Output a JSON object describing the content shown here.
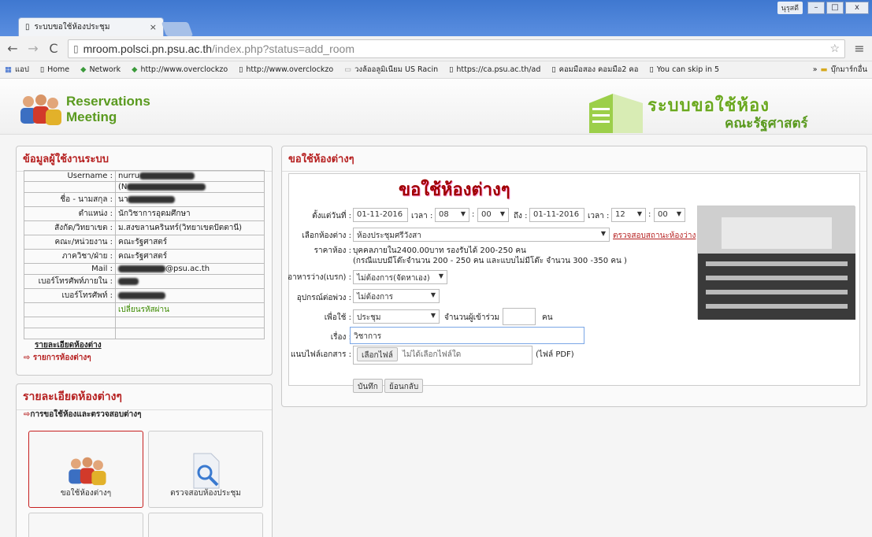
{
  "browser": {
    "tab_title": "ระบบขอใช้ห้องประชุม",
    "tab_close": "×",
    "user_badge": "นุรุสดี",
    "url_host": "mroom.polsci.pn.psu.ac.th",
    "url_path": "/index.php?status=add_room",
    "bookmarks": [
      "แอป",
      "Home",
      "Network",
      "http://www.overclockzo",
      "http://www.overclockzo",
      "วงล้ออลูมิเนียม US Racin",
      "https://ca.psu.ac.th/ad",
      "คอมมือสอง คอมมือ2 คอ",
      "You can skip in 5",
      "บุ๊กมาร์กอื่น"
    ]
  },
  "header": {
    "logo_line1": "Reservations",
    "logo_line2": "Meeting",
    "system_title": "ระบบขอใช้ห้อง",
    "system_subtitle": "คณะรัฐศาสตร์"
  },
  "user_panel": {
    "title": "ข้อมูลผู้ใช้งานระบบ",
    "rows": [
      {
        "k": "Username :",
        "v": "nurru"
      },
      {
        "k": "",
        "v": "(N"
      },
      {
        "k": "ชื่อ - นามสกุล :",
        "v": "นา"
      },
      {
        "k": "ตำแหน่ง :",
        "v": "นักวิชาการอุดมศึกษา"
      },
      {
        "k": "สังกัด/วิทยาเขต :",
        "v": "ม.สงขลานครินทร์(วิทยาเขตปัตตานี)"
      },
      {
        "k": "คณะ/หน่วยงาน :",
        "v": "คณะรัฐศาสตร์"
      },
      {
        "k": "ภาควิชา/ฝ่าย :",
        "v": "คณะรัฐศาสตร์"
      },
      {
        "k": "Mail :",
        "v": "@psu.ac.th"
      },
      {
        "k": "เบอร์โทรศัพท์ภายใน :",
        "v": ""
      },
      {
        "k": "เบอร์โทรศัพท์ :",
        "v": ""
      },
      {
        "k": "",
        "v": "เปลี่ยนรหัสผ่าน"
      }
    ],
    "room_detail_link": "รายละเอียดห้องต่าง",
    "room_list": "รายการห้องต่างๆ"
  },
  "detail_panel": {
    "title": "รายละเอียดห้องต่างๆ",
    "item": "การขอใช้ห้องและตรวจสอบต่างๆ",
    "buttons": [
      "ขอใช้ห้องต่างๆ",
      "ตรวจสอบห้องประชุม"
    ]
  },
  "form_panel": {
    "title": "ขอใช้ห้องต่างๆ",
    "form_title": "ขอใช้ห้องต่างๆ",
    "from_label": "ตั้งแต่วันที่ :",
    "from_date": "01-11-2016",
    "time_label": "เวลา :",
    "from_hour": "08",
    "from_min": "00",
    "to_label": "ถึง :",
    "to_date": "01-11-2016",
    "to_hour": "12",
    "to_min": "00",
    "room_label": "เลือกห้องต่าง :",
    "room_value": "ห้องประชุมศรีวังสา",
    "check_link": "ตรวจสอบสถานะห้องว่าง",
    "price_label": "ราคาห้อง :",
    "price_line1": "บุคคลภายใน2400.00บาท รองรับได้ 200-250 คน",
    "price_line2": "(กรณีแบบมีโต๊ะจำนวน 200 - 250 คน และแบบไม่มีโต๊ะ จำนวน 300 -350 คน )",
    "food_label": "อาหารว่าง(เบรก) :",
    "food_value": "ไม่ต้องการ(จัดหาเอง)",
    "equip_label": "อุปกรณ์ต่อพ่วง :",
    "equip_value": "ไม่ต้องการ",
    "purpose_label": "เพื่อใช้ :",
    "purpose_value": "ประชุม",
    "attend_label": "จำนวนผู้เข้าร่วม :",
    "attend_unit": "คน",
    "subject_label": "เรื่อง :",
    "subject_value": "วิชาการ",
    "attach_label": "แนบไฟล์เอกสาร :",
    "file_button": "เลือกไฟล์",
    "file_none": "ไม่ได้เลือกไฟล์ใด",
    "file_hint": "(ไฟล์ PDF)",
    "save_button": "บันทึก",
    "back_button": "ย้อนกลับ"
  }
}
